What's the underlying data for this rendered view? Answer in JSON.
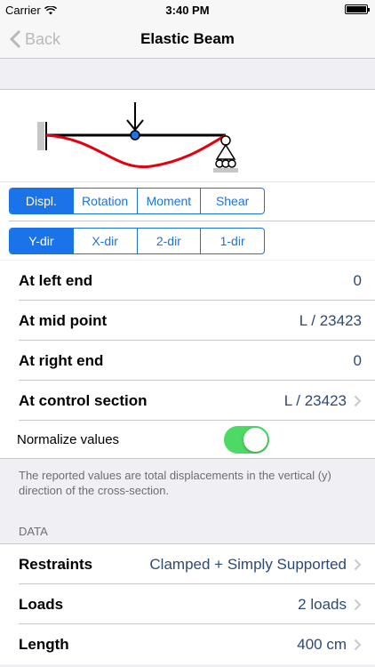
{
  "status": {
    "carrier": "Carrier",
    "time": "3:40 PM"
  },
  "nav": {
    "back": "Back",
    "title": "Elastic Beam"
  },
  "result_tabs": [
    "Displ.",
    "Rotation",
    "Moment",
    "Shear"
  ],
  "result_tab_selected": "Displ.",
  "direction_tabs": [
    "Y-dir",
    "X-dir",
    "2-dir",
    "1-dir"
  ],
  "direction_tab_selected": "Y-dir",
  "results": [
    {
      "label": "At left end",
      "value": "0"
    },
    {
      "label": "At mid point",
      "value": "L / 23423"
    },
    {
      "label": "At right end",
      "value": "0"
    },
    {
      "label": "At control section",
      "value": "L / 23423"
    }
  ],
  "normalize": {
    "label": "Normalize values",
    "on": true
  },
  "note": "The reported values are total displacements in the vertical (y) direction of the cross-section.",
  "data_header": "DATA",
  "data_rows": [
    {
      "label": "Restraints",
      "value": "Clamped + Simply Supported"
    },
    {
      "label": "Loads",
      "value": "2 loads"
    },
    {
      "label": "Length",
      "value": "400 cm"
    }
  ],
  "colors": {
    "accent": "#1a73e8",
    "deflection": "#e3000f",
    "toggle_on": "#4cd964"
  }
}
